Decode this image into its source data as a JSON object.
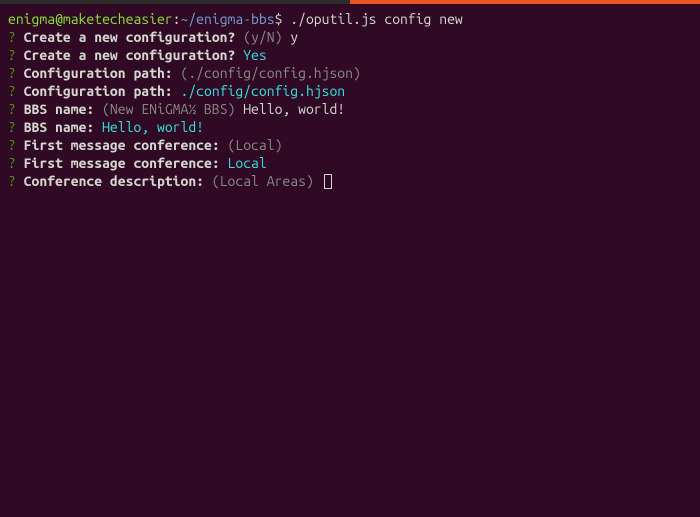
{
  "prompt": {
    "user": "enigma",
    "at": "@",
    "host": "maketecheasier",
    "colon": ":",
    "path": "~/enigma-bbs",
    "dollar": "$",
    "command": "./oputil.js config new"
  },
  "lines": [
    {
      "q": "?",
      "label": "Create a new configuration?",
      "hint": "(y/N)",
      "input": "y"
    },
    {
      "q": "?",
      "label": "Create a new configuration?",
      "answer": "Yes"
    },
    {
      "q": "?",
      "label": "Configuration path:",
      "hint": "(./config/config.hjson)"
    },
    {
      "q": "?",
      "label": "Configuration path:",
      "answer": "./config/config.hjson"
    },
    {
      "q": "?",
      "label": "BBS name:",
      "hint": "(New ENiGMA½ BBS)",
      "input": "Hello, world!"
    },
    {
      "q": "?",
      "label": "BBS name:",
      "answer": "Hello, world!"
    },
    {
      "q": "?",
      "label": "First message conference:",
      "hint": "(Local)"
    },
    {
      "q": "?",
      "label": "First message conference:",
      "answer": "Local"
    },
    {
      "q": "?",
      "label": "Conference description:",
      "hint": "(Local Areas)",
      "cursor": true
    }
  ]
}
